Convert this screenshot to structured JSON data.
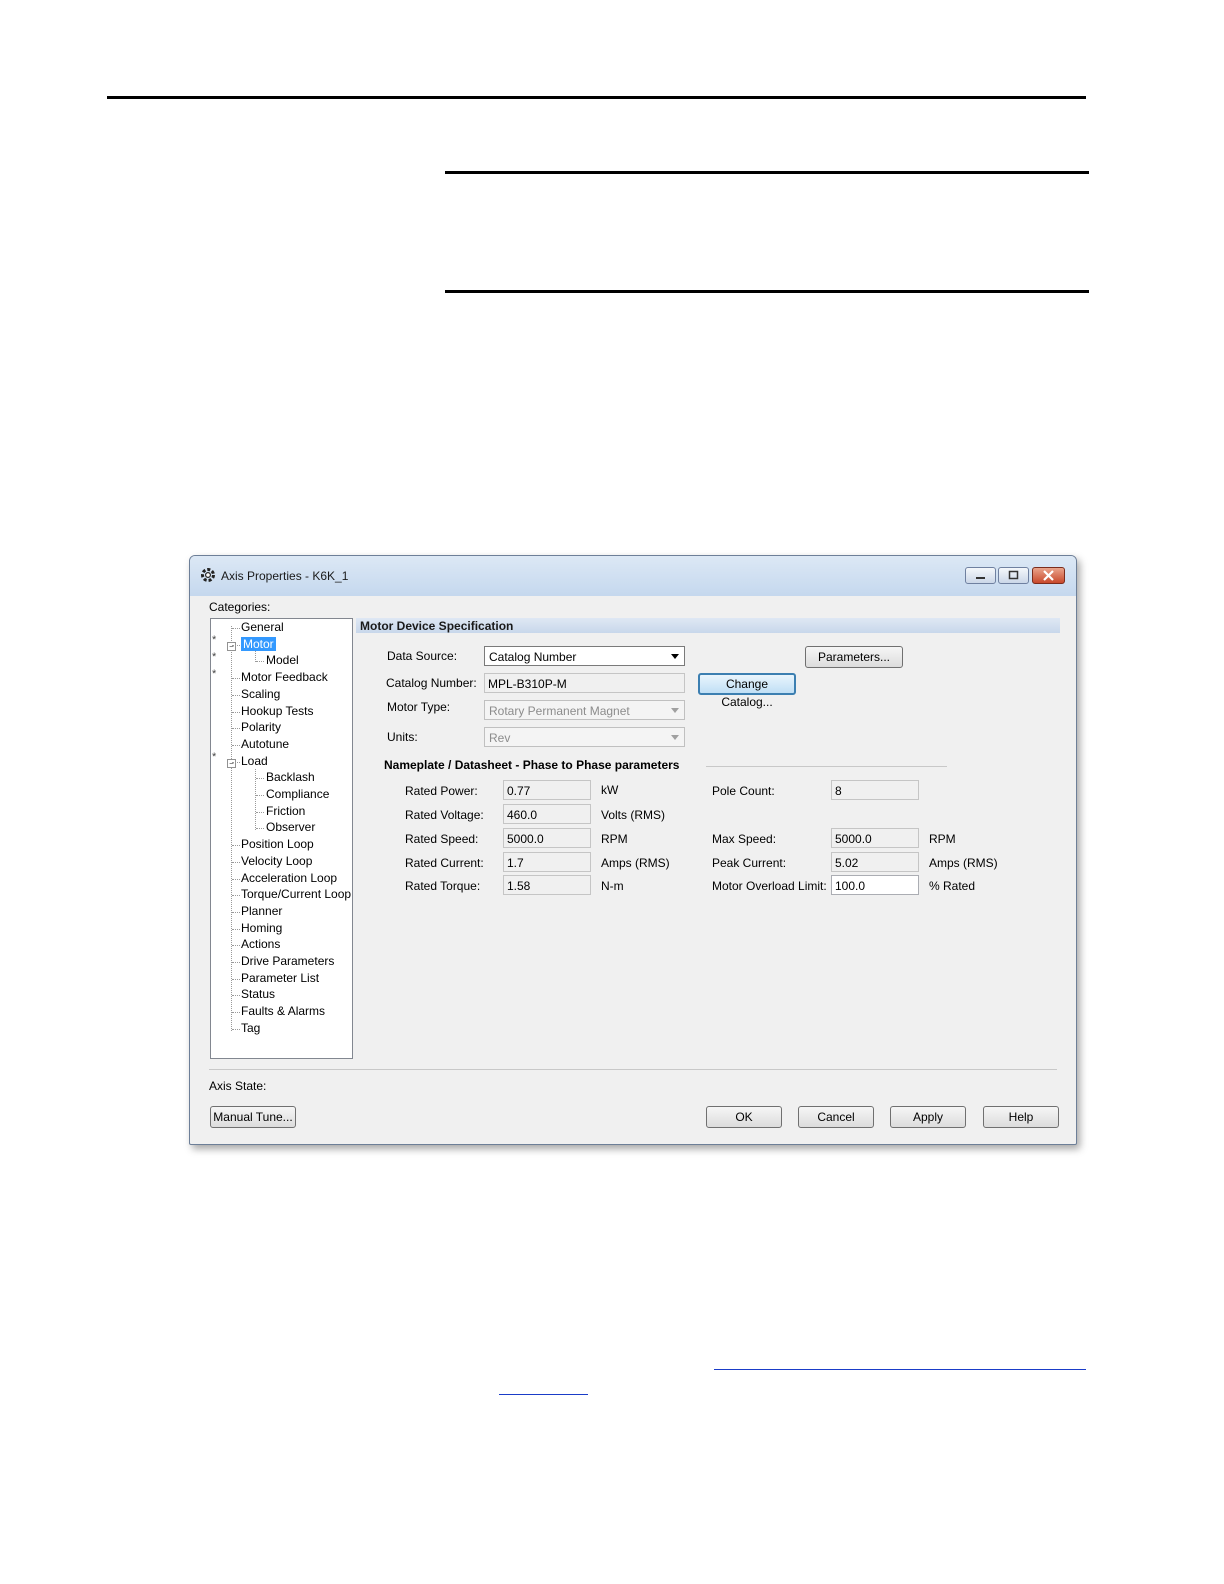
{
  "dialog": {
    "title": "Axis Properties - K6K_1",
    "categories_label": "Categories:",
    "axis_state_label": "Axis State:"
  },
  "tree": {
    "items": [
      {
        "label": "General"
      },
      {
        "label": "Motor",
        "selected": true
      },
      {
        "label": "Model"
      },
      {
        "label": "Motor Feedback"
      },
      {
        "label": "Scaling"
      },
      {
        "label": "Hookup Tests"
      },
      {
        "label": "Polarity"
      },
      {
        "label": "Autotune"
      },
      {
        "label": "Load"
      },
      {
        "label": "Backlash"
      },
      {
        "label": "Compliance"
      },
      {
        "label": "Friction"
      },
      {
        "label": "Observer"
      },
      {
        "label": "Position Loop"
      },
      {
        "label": "Velocity Loop"
      },
      {
        "label": "Acceleration Loop"
      },
      {
        "label": "Torque/Current Loop"
      },
      {
        "label": "Planner"
      },
      {
        "label": "Homing"
      },
      {
        "label": "Actions"
      },
      {
        "label": "Drive Parameters"
      },
      {
        "label": "Parameter List"
      },
      {
        "label": "Status"
      },
      {
        "label": "Faults & Alarms"
      },
      {
        "label": "Tag"
      }
    ]
  },
  "section": {
    "title": "Motor Device Specification"
  },
  "spec": {
    "data_source_label": "Data Source:",
    "data_source_value": "Catalog Number",
    "catalog_number_label": "Catalog Number:",
    "catalog_number_value": "MPL-B310P-M",
    "motor_type_label": "Motor Type:",
    "motor_type_value": "Rotary Permanent Magnet",
    "units_label": "Units:",
    "units_value": "Rev",
    "parameters_button": "Parameters...",
    "change_catalog_button": "Change Catalog..."
  },
  "nameplate": {
    "title": "Nameplate / Datasheet - Phase to Phase parameters",
    "rated_power_label": "Rated Power:",
    "rated_power_value": "0.77",
    "rated_power_unit": "kW",
    "rated_voltage_label": "Rated Voltage:",
    "rated_voltage_value": "460.0",
    "rated_voltage_unit": "Volts (RMS)",
    "rated_speed_label": "Rated Speed:",
    "rated_speed_value": "5000.0",
    "rated_speed_unit": "RPM",
    "rated_current_label": "Rated Current:",
    "rated_current_value": "1.7",
    "rated_current_unit": "Amps (RMS)",
    "rated_torque_label": "Rated Torque:",
    "rated_torque_value": "1.58",
    "rated_torque_unit": "N-m",
    "pole_count_label": "Pole Count:",
    "pole_count_value": "8",
    "max_speed_label": "Max Speed:",
    "max_speed_value": "5000.0",
    "max_speed_unit": "RPM",
    "peak_current_label": "Peak Current:",
    "peak_current_value": "5.02",
    "peak_current_unit": "Amps (RMS)",
    "overload_label": "Motor Overload Limit:",
    "overload_value": "100.0",
    "overload_unit": "% Rated"
  },
  "buttons": {
    "manual_tune": "Manual Tune...",
    "ok": "OK",
    "cancel": "Cancel",
    "apply": "Apply",
    "help": "Help"
  }
}
